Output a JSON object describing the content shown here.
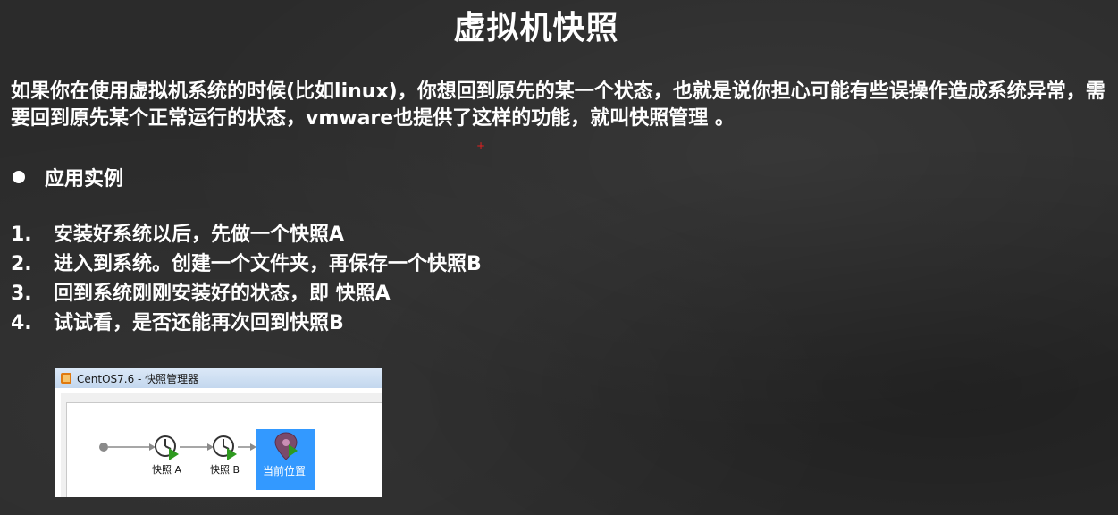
{
  "slide": {
    "title": "虚拟机快照",
    "intro": "如果你在使用虚拟机系统的时候(比如linux)，你想回到原先的某一个状态，也就是说你担心可能有些误操作造成系统异常，需要回到原先某个正常运行的状态，vmware也提供了这样的功能，就叫快照管理 。",
    "bullet": "应用实例",
    "steps": [
      {
        "num": "1.",
        "text": "安装好系统以后，先做一个快照A"
      },
      {
        "num": "2.",
        "text": "进入到系统。创建一个文件夹，再保存一个快照B"
      },
      {
        "num": "3.",
        "text": "回到系统刚刚安装好的状态，即 快照A"
      },
      {
        "num": "4.",
        "text": "试试看，是否还能再次回到快照B"
      }
    ]
  },
  "snapshot_window": {
    "title": "CentOS7.6 - 快照管理器",
    "snapshots": [
      {
        "label": "快照 A",
        "icon": "clock-play-icon"
      },
      {
        "label": "快照 B",
        "icon": "clock-play-icon"
      }
    ],
    "current_label": "当前位置",
    "current_icon": "location-pin-icon",
    "colors": {
      "selection": "#3399ff",
      "play": "#2e9a1f"
    }
  }
}
